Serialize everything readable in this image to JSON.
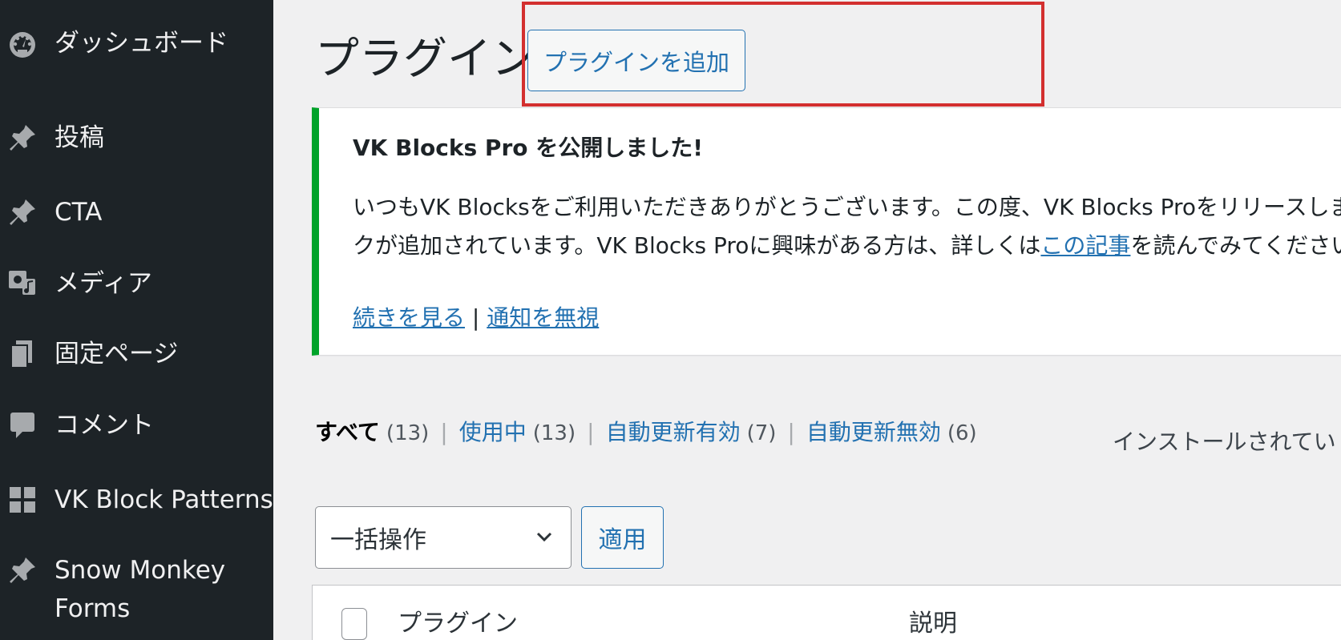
{
  "sidebar": {
    "items": [
      {
        "label": "ダッシュボード",
        "icon": "dashboard-icon"
      },
      {
        "label": "投稿",
        "icon": "pin-icon"
      },
      {
        "label": "CTA",
        "icon": "pin-icon"
      },
      {
        "label": "メディア",
        "icon": "media-icon"
      },
      {
        "label": "固定ページ",
        "icon": "page-icon"
      },
      {
        "label": "コメント",
        "icon": "comment-icon"
      },
      {
        "label": "VK Block Patterns",
        "icon": "grid-icon"
      },
      {
        "label": "Snow Monkey Forms",
        "icon": "pin-icon"
      }
    ]
  },
  "header": {
    "title": "プラグイン",
    "add_button": "プラグインを追加"
  },
  "notice": {
    "title": "VK Blocks Pro を公開しました!",
    "line1": "いつもVK Blocksをご利用いただきありがとうございます。この度、VK Blocks Proをリリースしまし",
    "line2_pre": "クが追加されています。VK Blocks Proに興味がある方は、詳しくは",
    "line2_link": "この記事",
    "line2_post": "を読んでみてください",
    "more_link": "続きを見る",
    "separator": "|",
    "dismiss_link": "通知を無視"
  },
  "filters": {
    "all": {
      "label": "すべて",
      "count": "(13)"
    },
    "active": {
      "label": "使用中",
      "count": "(13)"
    },
    "auto_on": {
      "label": "自動更新有効",
      "count": "(7)"
    },
    "auto_off": {
      "label": "自動更新無効",
      "count": "(6)"
    },
    "separator": "|"
  },
  "search_hint": "インストールされてい",
  "bulk": {
    "selected": "一括操作",
    "apply": "適用"
  },
  "table": {
    "col_plugin": "プラグイン",
    "col_description": "説明"
  },
  "colors": {
    "sidebar_bg": "#1d2327",
    "accent": "#2271b1",
    "notice_border": "#00a32a",
    "highlight": "#d32f2f"
  }
}
